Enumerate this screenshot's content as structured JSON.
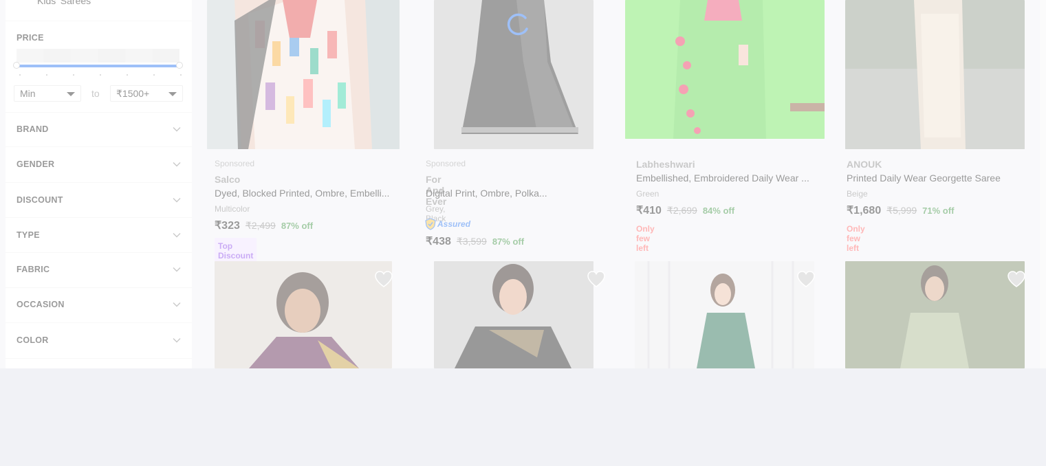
{
  "sidebar": {
    "category_link": "Kids' Sarees",
    "price": {
      "title": "PRICE",
      "min_select": "Min",
      "to_label": "to",
      "max_select": "₹1500+"
    },
    "facets": [
      "BRAND",
      "GENDER",
      "DISCOUNT",
      "TYPE",
      "FABRIC",
      "OCCASION",
      "COLOR"
    ]
  },
  "products": [
    {
      "sponsored": "Sponsored",
      "brand": "Salco",
      "title": "Dyed, Blocked Printed, Ombre, Embelli...",
      "color": "Multicolor",
      "price": "₹323",
      "mrp": "₹2,499",
      "off": "87% off",
      "badge": "Top Discount of the Sale"
    },
    {
      "sponsored": "Sponsored",
      "brand": "For And Ever",
      "title": "Digital Print, Ombre, Polka...",
      "color": "Grey, Black",
      "assured": "Assured",
      "price": "₹438",
      "mrp": "₹3,599",
      "off": "87% off"
    },
    {
      "brand": "Labheshwari",
      "title": "Embellished, Embroidered Daily Wear ...",
      "color": "Green",
      "price": "₹410",
      "mrp": "₹2,699",
      "off": "84% off",
      "stock": "Only few left"
    },
    {
      "brand": "ANOUK",
      "title": "Printed Daily Wear Georgette Saree",
      "color": "Beige",
      "price": "₹1,680",
      "mrp": "₹5,999",
      "off": "71% off",
      "stock": "Only few left"
    }
  ],
  "icons": {
    "wishlist": "heart-icon",
    "expand": "chevron-down-icon",
    "assured": "shield-icon",
    "loading": "spinner-icon"
  },
  "colors": {
    "accent": "#2874f0",
    "discount": "#388e3c",
    "stock_warning": "#ff6161",
    "badge_bg": "#efe3ff",
    "badge_text": "#8b47e8",
    "page_bg": "#f1f2f6"
  }
}
